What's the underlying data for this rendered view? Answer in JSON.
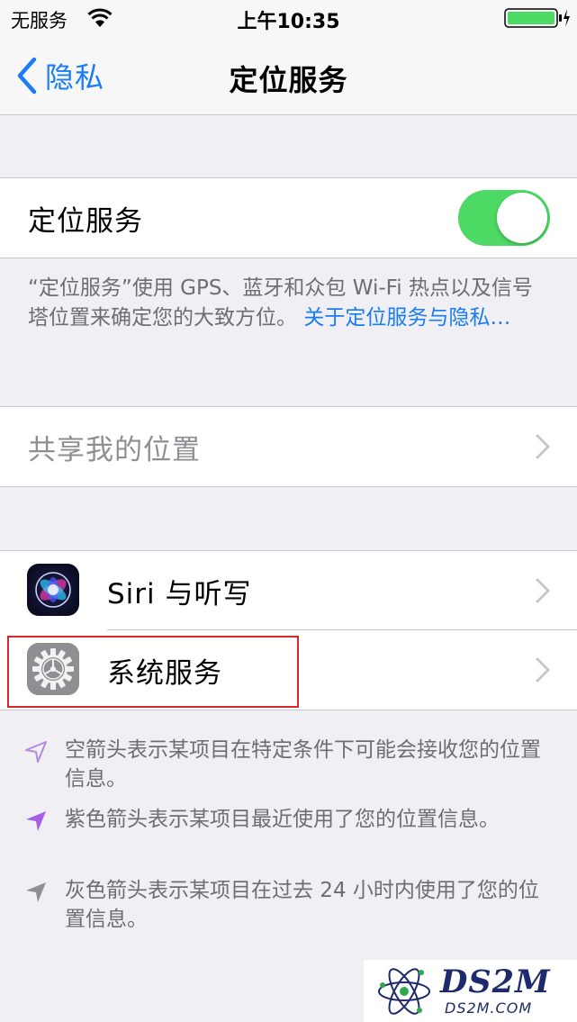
{
  "status_bar": {
    "carrier": "无服务",
    "time": "上午10:35",
    "icons": [
      "wifi-icon",
      "battery-charging-icon"
    ]
  },
  "nav": {
    "back_label": "隐私",
    "title": "定位服务"
  },
  "location_services": {
    "label": "定位服务",
    "toggle_on": true,
    "description": "“定位服务”使用 GPS、蓝牙和众包 Wi-Fi 热点以及信号塔位置来确定您的大致方位。",
    "link": "关于定位服务与隐私…"
  },
  "share_location": {
    "label": "共享我的位置"
  },
  "apps": [
    {
      "label": "Siri 与听写",
      "icon": "siri-icon"
    },
    {
      "label": "系统服务",
      "icon": "settings-gear-icon"
    }
  ],
  "legend": [
    {
      "icon": "hollow-arrow-icon",
      "color": "#b58ae0",
      "text": "空箭头表示某项目在特定条件下可能会接收您的位置信息。"
    },
    {
      "icon": "purple-arrow-icon",
      "color": "#a55fe6",
      "text": "紫色箭头表示某项目最近使用了您的位置信息。"
    },
    {
      "icon": "gray-arrow-icon",
      "color": "#8e8e93",
      "text": "灰色箭头表示某项目在过去 24 小时内使用了您的位置信息。"
    }
  ],
  "watermark": {
    "main": "DS2M",
    "sub": "DS2M.COM"
  },
  "colors": {
    "accent": "#1a7cf5",
    "toggle_on": "#4cd964",
    "highlight": "#d9272e",
    "background": "#efeff4"
  }
}
